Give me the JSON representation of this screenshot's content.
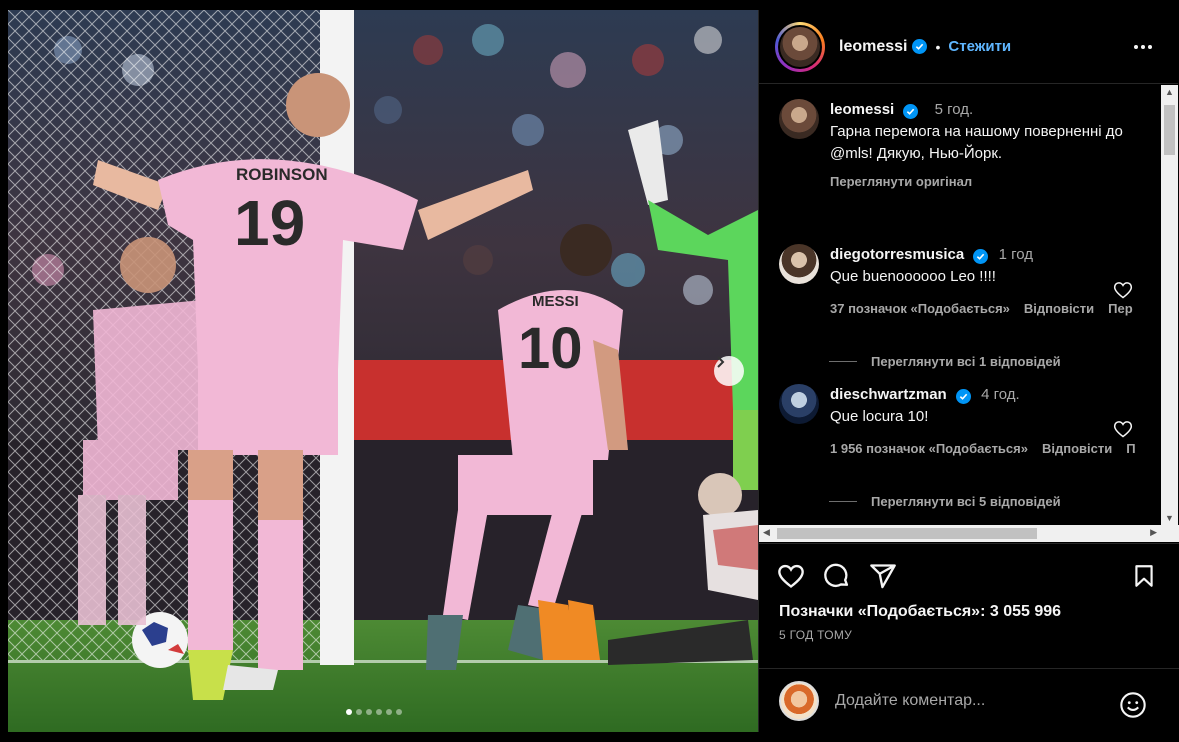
{
  "post": {
    "username": "leomessi",
    "separator": "•",
    "follow_label": "Стежити",
    "more_icon": "more-horizontal-icon"
  },
  "caption": {
    "username": "leomessi",
    "time": "5 год.",
    "text": "Гарна перемога на нашому поверненні до @mls! Дякую, Нью-Йорк.",
    "translate_label": "Переглянути оригінал"
  },
  "comments": [
    {
      "username": "diegotorresmusica",
      "time": "1 год",
      "text": "Que buenoooooo Leo !!!!",
      "likes": "37 позначок «Подобається»",
      "reply_label": "Відповісти",
      "extra_label": "Пер",
      "view_replies": "Переглянути всі 1 відповідей"
    },
    {
      "username": "dieschwartzman",
      "time": "4 год.",
      "text": "Que locura 10!",
      "likes": "1 956 позначок «Подобається»",
      "reply_label": "Відповісти",
      "extra_label": "П",
      "view_replies": "Переглянути всі 5 відповідей"
    }
  ],
  "actions": {
    "likes_text": "Позначки «Подобається»: 3 055 996",
    "time_ago": "5 ГОД ТОМУ"
  },
  "add_comment": {
    "placeholder": "Додайте коментар..."
  },
  "carousel": {
    "slide_count": 6,
    "active_index": 0
  },
  "photo": {
    "jersey_19_name": "ROBINSON",
    "jersey_19_number": "19",
    "jersey_10_name": "MESSI",
    "jersey_10_number": "10"
  },
  "colors": {
    "link_blue": "#5fb6ff",
    "verified_blue": "#0095f6",
    "jersey_pink": "#f2b8d6",
    "pitch_green": "#3f7a2e"
  }
}
